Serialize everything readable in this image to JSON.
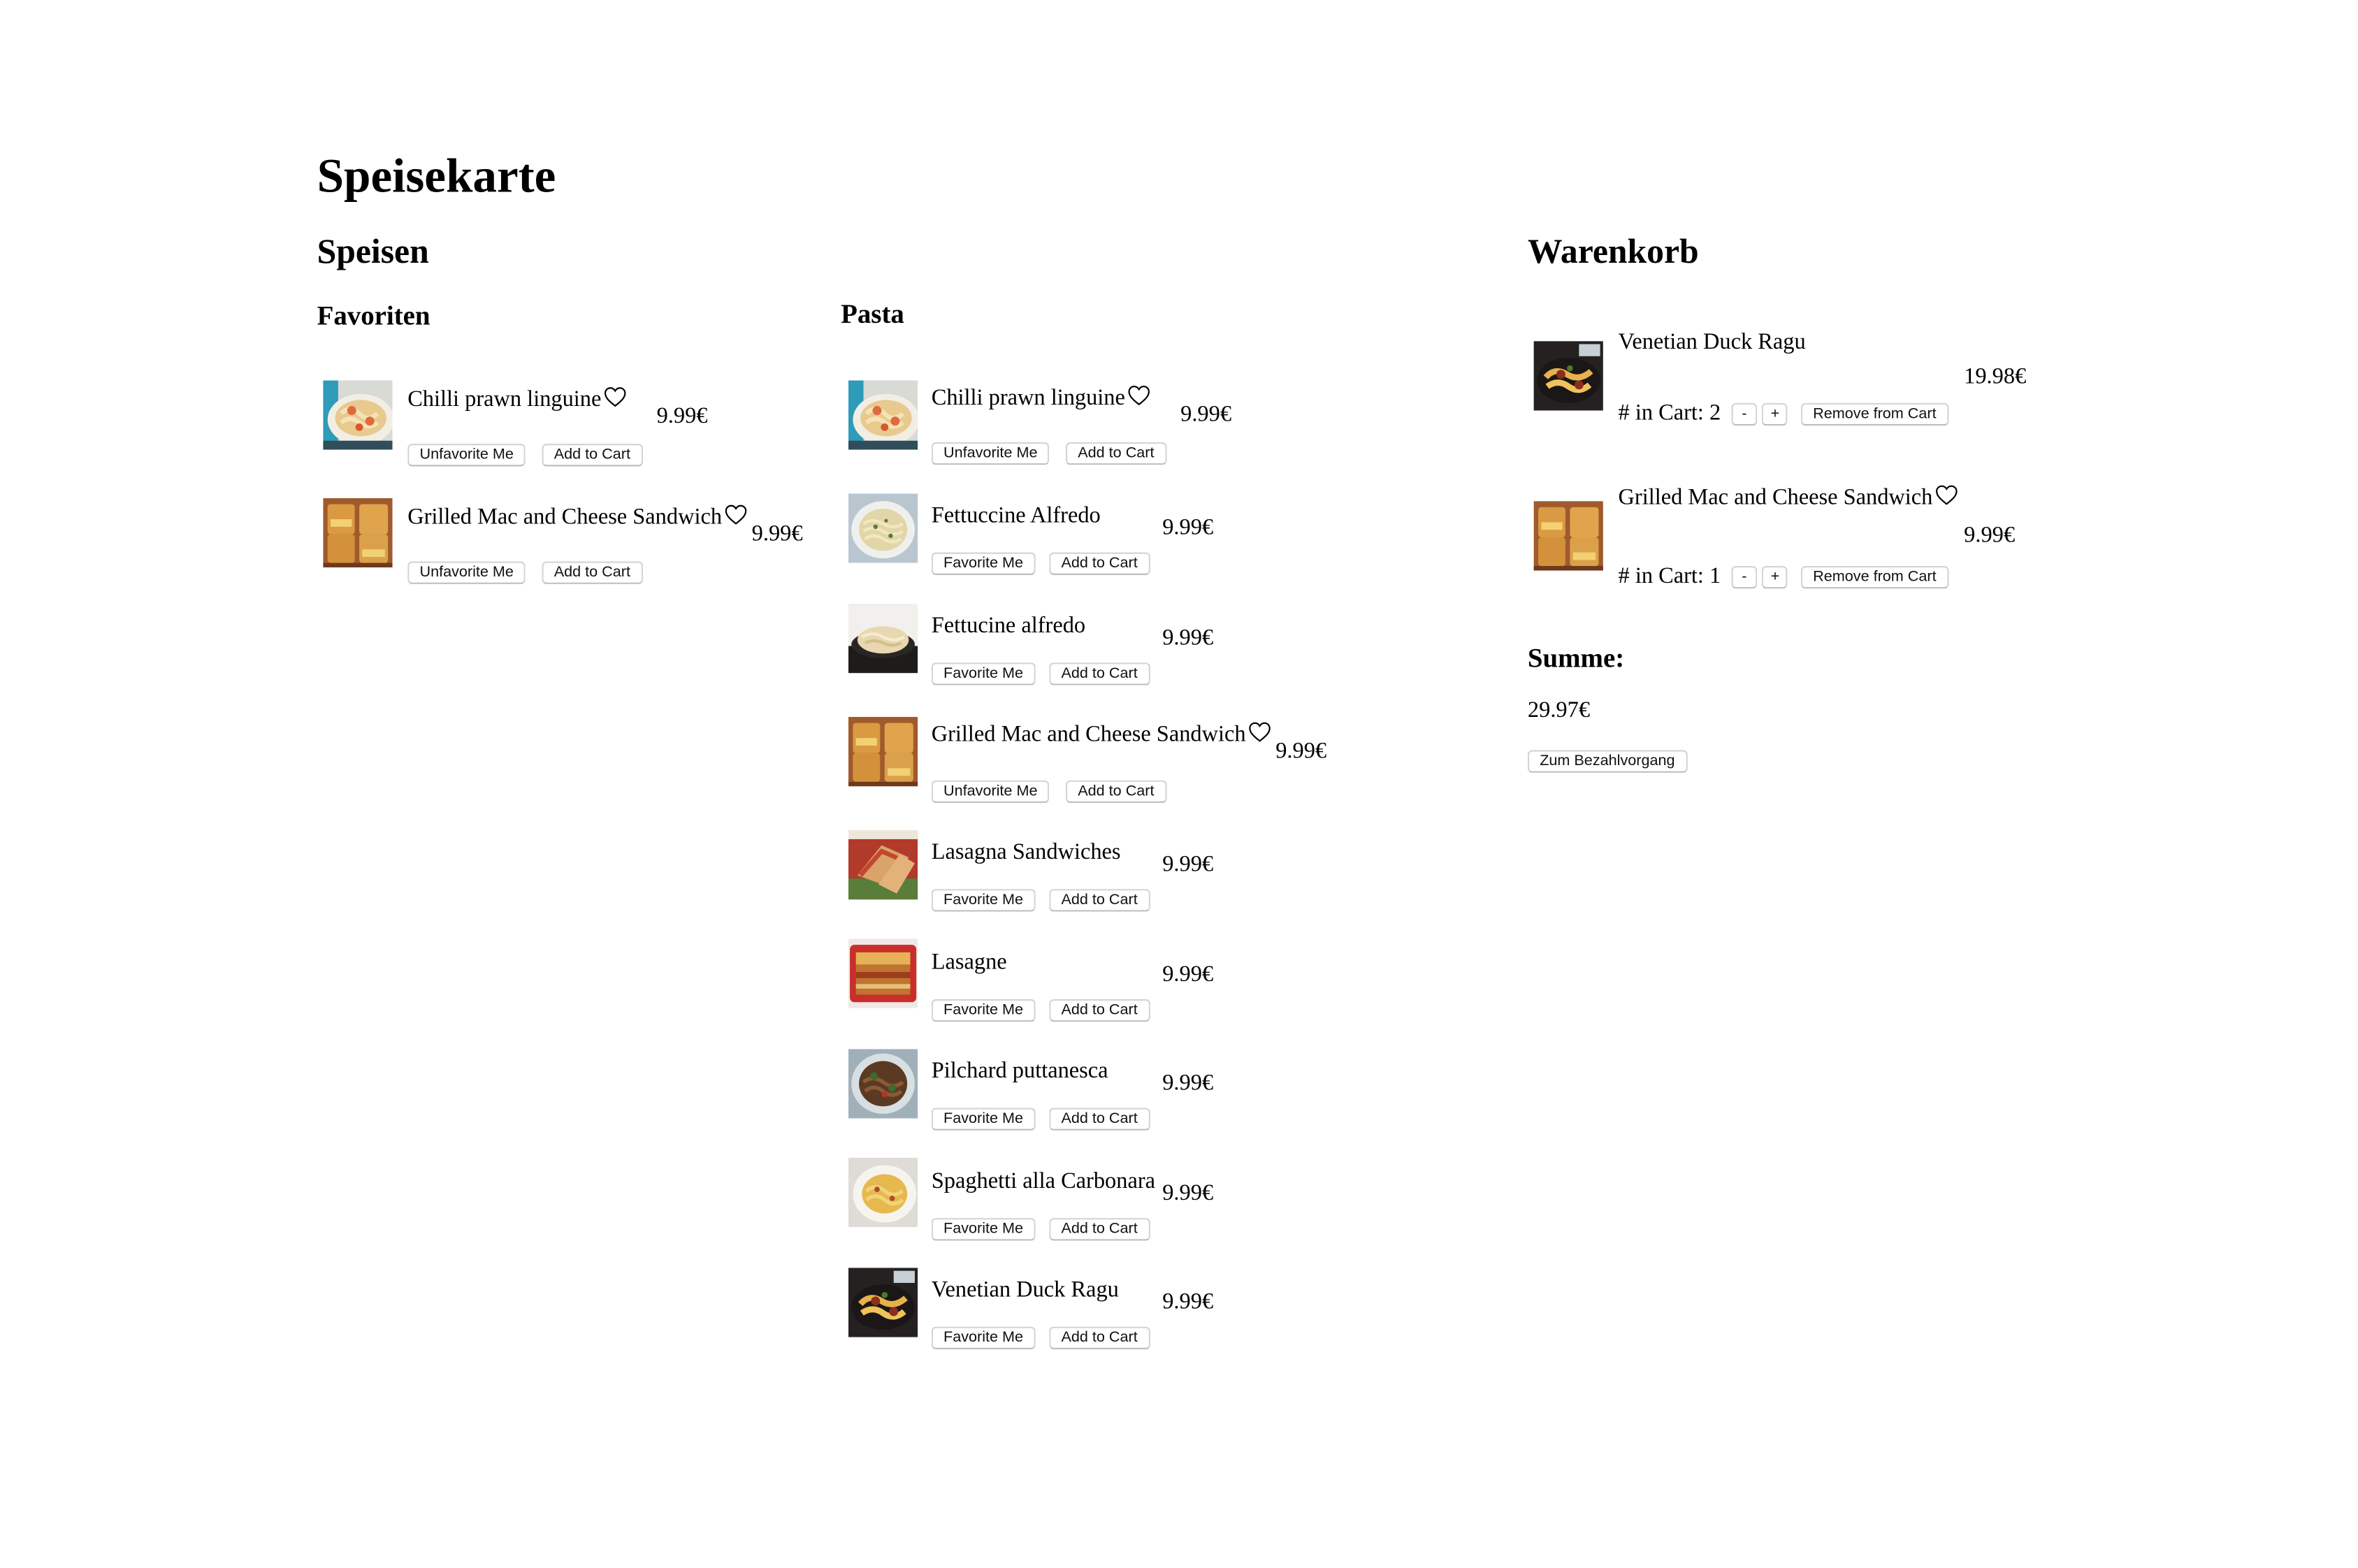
{
  "page": {
    "title": "Speisekarte",
    "menu_heading": "Speisen",
    "favorites_heading": "Favoriten",
    "pasta_heading": "Pasta",
    "cart_heading": "Warenkorb"
  },
  "favorites": [
    {
      "name": "Chilli prawn linguine",
      "price": "9.99€",
      "favorite_label": "Unfavorite Me",
      "add_label": "Add to Cart",
      "favorited": true
    },
    {
      "name": "Grilled Mac and Cheese Sandwich",
      "price": "9.99€",
      "favorite_label": "Unfavorite Me",
      "add_label": "Add to Cart",
      "favorited": true
    }
  ],
  "pasta": [
    {
      "name": "Chilli prawn linguine",
      "price": "9.99€",
      "favorite_label": "Unfavorite Me",
      "add_label": "Add to Cart",
      "favorited": true
    },
    {
      "name": "Fettuccine Alfredo",
      "price": "9.99€",
      "favorite_label": "Favorite Me",
      "add_label": "Add to Cart",
      "favorited": false
    },
    {
      "name": "Fettucine alfredo",
      "price": "9.99€",
      "favorite_label": "Favorite Me",
      "add_label": "Add to Cart",
      "favorited": false
    },
    {
      "name": "Grilled Mac and Cheese Sandwich",
      "price": "9.99€",
      "favorite_label": "Unfavorite Me",
      "add_label": "Add to Cart",
      "favorited": true
    },
    {
      "name": "Lasagna Sandwiches",
      "price": "9.99€",
      "favorite_label": "Favorite Me",
      "add_label": "Add to Cart",
      "favorited": false
    },
    {
      "name": "Lasagne",
      "price": "9.99€",
      "favorite_label": "Favorite Me",
      "add_label": "Add to Cart",
      "favorited": false
    },
    {
      "name": "Pilchard puttanesca",
      "price": "9.99€",
      "favorite_label": "Favorite Me",
      "add_label": "Add to Cart",
      "favorited": false
    },
    {
      "name": "Spaghetti alla Carbonara",
      "price": "9.99€",
      "favorite_label": "Favorite Me",
      "add_label": "Add to Cart",
      "favorited": false
    },
    {
      "name": "Venetian Duck Ragu",
      "price": "9.99€",
      "favorite_label": "Favorite Me",
      "add_label": "Add to Cart",
      "favorited": false
    }
  ],
  "cart": {
    "items": [
      {
        "name": "Venetian Duck Ragu",
        "price": "19.98€",
        "count_text": "# in Cart: 2",
        "minus_label": "-",
        "plus_label": "+",
        "remove_label": "Remove from Cart",
        "favorited": false
      },
      {
        "name": "Grilled Mac and Cheese Sandwich",
        "price": "9.99€",
        "count_text": "# in Cart: 1",
        "minus_label": "-",
        "plus_label": "+",
        "remove_label": "Remove from Cart",
        "favorited": true
      }
    ],
    "sum_heading": "Summe:",
    "sum_value": "29.97€",
    "checkout_label": "Zum Bezahlvorgang"
  }
}
